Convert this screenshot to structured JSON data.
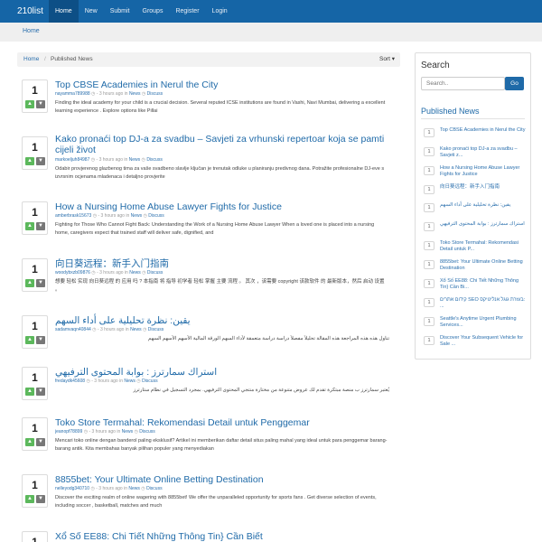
{
  "navbar": {
    "brand": "210list",
    "links": [
      "Home",
      "New",
      "Submit",
      "Groups",
      "Register",
      "Login"
    ],
    "active": "Home",
    "color": "#1565a6"
  },
  "top_breadcrumb": "Home",
  "breadcrumb": {
    "home": "Home",
    "current": "Published News",
    "separator": "/"
  },
  "sort_label": "Sort ▾",
  "stories": [
    {
      "votes": "1",
      "title": "Top CBSE Academies in Nerul the City",
      "author": "nayamma789988",
      "time": "3 hours ago",
      "category": "News",
      "discuss": "Discuss",
      "description": "Finding the ideal academy for your child is a crucial decision. Several reputed ICSE institutions are found in Vashi, Navi Mumbai, delivering a excellent learning experience . Explore options like Pillai"
    },
    {
      "votes": "1",
      "title": "Kako pronaći top DJ-a za svadbu – Savjeti za vrhunski repertoar koja se pamti cijeli život",
      "author": "markoeljuh84987",
      "time": "3 hours ago",
      "category": "News",
      "discuss": "Discuss",
      "description": "Odabir provjerenog glazbenog tima za vaše svadbeno slavlje ključan je trenutak odluke u planiranju predivnog dana. Potražite profesionalne DJ-eve s izvrsnim ocjenama mladenaca i detaljno provjerite"
    },
    {
      "votes": "1",
      "title": "How a Nursing Home Abuse Lawyer Fights for Justice",
      "author": "amberbrask15673",
      "time": "3 hours ago",
      "category": "News",
      "discuss": "Discuss",
      "description": "Fighting for Those Who Cannot Fight Back: Understanding the Work of a Nursing Home Abuse Lawyer When a loved one is placed into a nursing home, caregivers expect that trained staff will deliver safe, dignified, and"
    },
    {
      "votes": "1",
      "title": "向日葵远程：新手入门指南",
      "author": "woodybxzb09876",
      "time": "3 hours ago",
      "category": "News",
      "discuss": "Discuss",
      "description": "想要 轻松 实现 向日葵远程 的 应用 吗 ? 本指南 将 指导 初学者 轻松 掌握 主要 流程 。 其次 ，该需要 copyright 该款软件 的 最新版本，然后 启动 设置 。"
    },
    {
      "votes": "1",
      "title": "يقين: نظرة تحليلية على أداء السهم",
      "author": "sadamvaqn40844",
      "time": "3 hours ago",
      "category": "News",
      "discuss": "Discuss",
      "description": "تناول هذه هذه المراجعة هذه المقالة تحليلاً مفصلاً دراسة دراسة متعمقة لأداء السهم الورقة المالية الأسهم الأسهم السهم"
    },
    {
      "votes": "1",
      "title": "استراك سمارترز : بوابة المحتوى الترفيهي",
      "author": "fredaydk45608",
      "time": "3 hours ago",
      "category": "News",
      "discuss": "Discuss",
      "description": "يُعتبر سمارترز ب منصة مبتكرة تقدم لك عروض متنوعة من مختارة منتجي المحتوى الترفيهي. بمجرد التسجيل في نظام ستارترز"
    },
    {
      "votes": "1",
      "title": "Toko Store Termahal: Rekomendasi Detail untuk Penggemar",
      "author": "jeanopf78899",
      "time": "3 hours ago",
      "category": "News",
      "discuss": "Discuss",
      "description": "Mencari toko online dengan banderol paling eksklusif? Artikel ini memberikan daftar detail situs paling mahal yang ideal untuk para penggemar barang-barang antik. Kita membahas banyak pilihan populer yang menyediakan"
    },
    {
      "votes": "1",
      "title": "8855bet: Your Ultimate Online Betting Destination",
      "author": "nelleyodg340710",
      "time": "3 hours ago",
      "category": "News",
      "discuss": "Discuss",
      "description": "Discover the exciting realm of online wagering with 8855bet! We offer the unparalleled opportunity for sports fans . Get diverse selection of events, including soccer , basketball, matches and much"
    },
    {
      "votes": "1",
      "title": "Xổ Số EE88: Chi Tiết Những Thông Tin} Cần Biết",
      "author": "",
      "time": "",
      "category": "",
      "discuss": "",
      "description": ""
    }
  ],
  "sidebar": {
    "search_heading": "Search",
    "search_placeholder": "Search..",
    "go_label": "Go",
    "published_heading": "Published News",
    "items": [
      {
        "num": "1",
        "text": "Top CBSE Academies in Nerul the City"
      },
      {
        "num": "1",
        "text": "Kako pronaći top DJ-a za svadbu – Savjeti z..."
      },
      {
        "num": "1",
        "text": "How a Nursing Home Abuse Lawyer Fights for Justice"
      },
      {
        "num": "1",
        "text": "向日葵远程：新手入门指南"
      },
      {
        "num": "1",
        "text": "يقين: نظرة تحليلية على أداء السهم"
      },
      {
        "num": "1",
        "text": "استراك سمارترز : بوابة المحتوى الترفيهي"
      },
      {
        "num": "1",
        "text": "Toko Store Termahal: Rekomendasi Detail untuk P..."
      },
      {
        "num": "1",
        "text": "8855bet: Your Ultimate Online Betting Destination"
      },
      {
        "num": "1",
        "text": "Xổ Số EE88: Chi Tiết Những Thông Tin} Cần Bi..."
      },
      {
        "num": "1",
        "text": "קידום אתרים SEO בעזרת גוגל אנליטיקס: ..."
      },
      {
        "num": "1",
        "text": "Seattle's Anytime Urgent Plumbing Services..."
      },
      {
        "num": "1",
        "text": "Discover Your Subsequent Vehicle for Sale ..."
      }
    ]
  }
}
